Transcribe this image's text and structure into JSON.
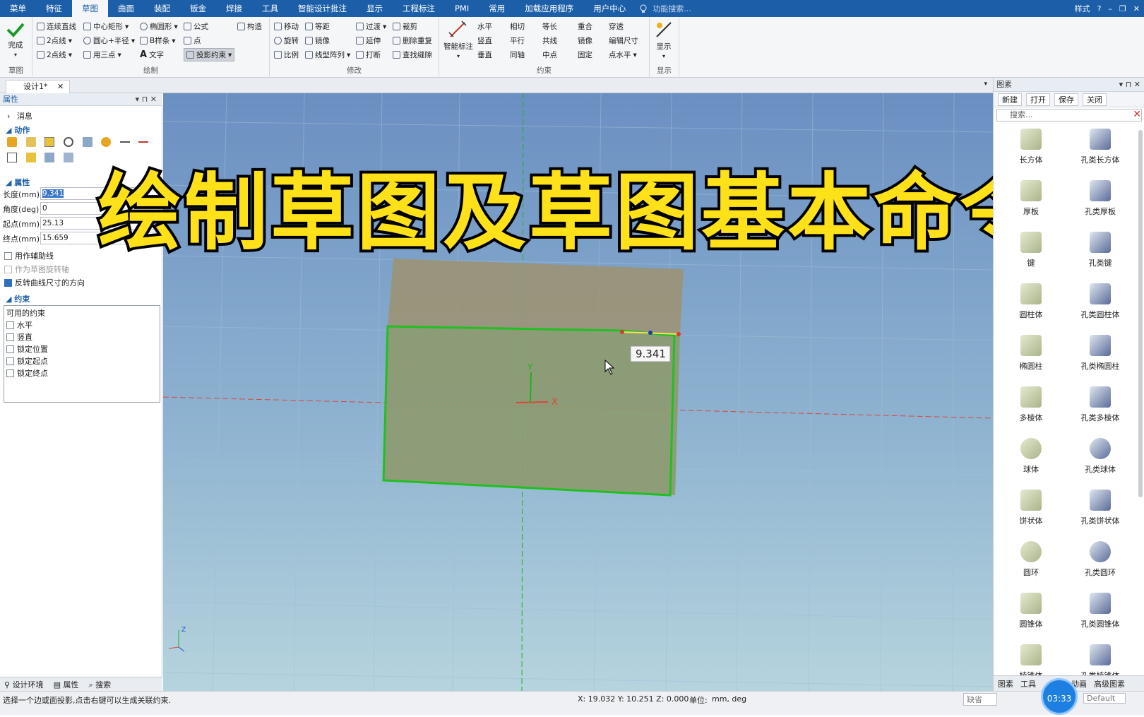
{
  "menu": {
    "items": [
      "菜单",
      "特征",
      "草图",
      "曲面",
      "装配",
      "钣金",
      "焊接",
      "工具",
      "智能设计批注",
      "显示",
      "工程标注",
      "PMI",
      "常用",
      "加载应用程序",
      "用户中心"
    ],
    "active_index": 2,
    "search_placeholder": "功能搜索...",
    "style_label": "样式"
  },
  "ribbon": {
    "finish": {
      "label": "完成",
      "group": "草图"
    },
    "draw": {
      "group": "绘制",
      "items": [
        "连续直线",
        "中心矩形",
        "椭圆形",
        "公式",
        "2点线",
        "圆心+半径",
        "B样条",
        "点",
        "2点线",
        "用三点",
        "文字",
        "投影约束",
        "构造"
      ]
    },
    "modify": {
      "group": "修改",
      "items": [
        "移动",
        "等距",
        "过渡",
        "裁剪",
        "旋转",
        "镜像",
        "延伸",
        "删除重复",
        "比例",
        "线型阵列",
        "打断",
        "查找缝隙"
      ]
    },
    "constraint": {
      "group": "约束",
      "smart_dim": "智能标注",
      "items": [
        "水平",
        "相切",
        "等长",
        "重合",
        "穿透",
        "竖直",
        "平行",
        "共线",
        "镜像",
        "编辑尺寸",
        "垂直",
        "同轴",
        "中点",
        "固定",
        "点水平"
      ]
    },
    "display": {
      "group": "显示",
      "label": "显示"
    }
  },
  "doc_tab": {
    "label": "设计1*"
  },
  "left_panel": {
    "header": "属性",
    "message": "消息",
    "action": "动作",
    "properties": "属性",
    "fields": [
      {
        "label": "长度(mm)",
        "value": "9.341"
      },
      {
        "label": "角度(deg)",
        "value": "0"
      },
      {
        "label": "起点(mm)",
        "value": "25.13"
      },
      {
        "label": "终点(mm)",
        "value": "15.659"
      }
    ],
    "options": [
      {
        "label": "用作辅助线",
        "checked": false
      },
      {
        "label": "作为草图旋转轴",
        "checked": false,
        "disabled": true
      },
      {
        "label": "反转曲线尺寸的方向",
        "checked": true
      }
    ],
    "constraint_title": "约束",
    "available_title": "可用的约束",
    "constraints": [
      "水平",
      "竖直",
      "锁定位置",
      "锁定起点",
      "锁定终点"
    ],
    "footer": [
      "设计环境",
      "属性",
      "搜索"
    ]
  },
  "viewport": {
    "dimension_value": "9.341",
    "x_axis_label": "X",
    "y_axis_label": "Y",
    "z_label": "Z"
  },
  "overlay_title": "绘制草图及草图基本命令",
  "right_panel": {
    "header": "图素",
    "toolbar": [
      "新建",
      "打开",
      "保存",
      "关闭"
    ],
    "search_placeholder": "搜索...",
    "items": [
      "长方体",
      "孔类长方体",
      "厚板",
      "孔类厚板",
      "键",
      "孔类键",
      "圆柱体",
      "孔类圆柱体",
      "椭圆柱",
      "孔类椭圆柱",
      "多棱体",
      "孔类多棱体",
      "球体",
      "孔类球体",
      "饼状体",
      "孔类饼状体",
      "圆环",
      "孔类圆环",
      "圆锥体",
      "孔类圆锥体",
      "棱锥体",
      "孔类棱锥体"
    ],
    "footer": [
      "图素",
      "工具",
      "动画",
      "高级图素"
    ]
  },
  "status": {
    "hint": "选择一个边或面投影,点击右键可以生成关联约束.",
    "coords": "X: 19.032 Y: 10.251 Z: 0.000",
    "unit_label": "单位:",
    "unit_value": "mm, deg",
    "combo1": "缺省",
    "combo2": "Default",
    "timer": "03:33"
  },
  "colors": {
    "menu_bg": "#1c5fa8",
    "sketch_green": "#20c020",
    "title_yellow": "#ffe11a"
  }
}
